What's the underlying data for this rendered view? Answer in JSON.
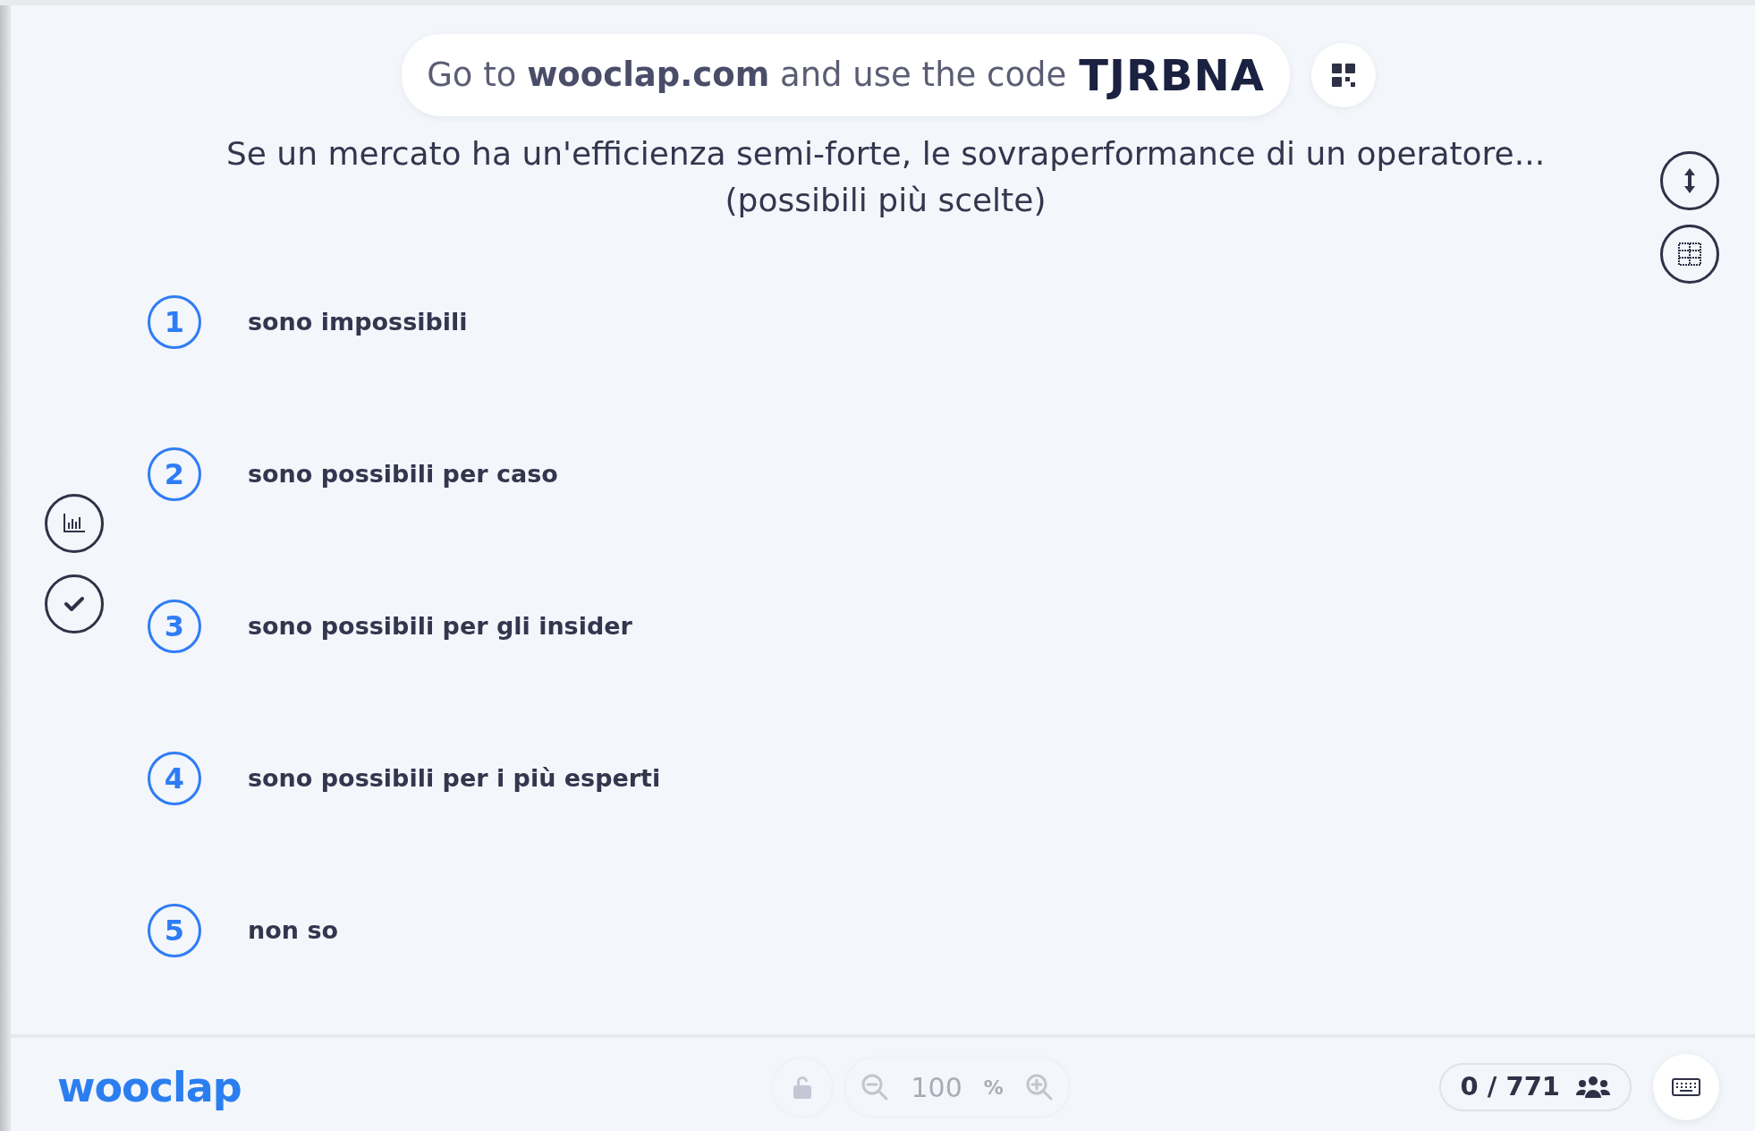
{
  "banner": {
    "instruction": "Go to **wooclap.com** and use the code",
    "code": "TJRBNA"
  },
  "question": {
    "title": "Se un mercato ha un'efficienza semi-forte, le sovraperformance di un operatore...",
    "note": "(possibili più scelte)"
  },
  "options": [
    {
      "number": "1",
      "label": "sono impossibili"
    },
    {
      "number": "2",
      "label": "sono possibili per caso"
    },
    {
      "number": "3",
      "label": "sono possibili per gli insider"
    },
    {
      "number": "4",
      "label": "sono possibili per i più esperti"
    },
    {
      "number": "5",
      "label": "non so"
    }
  ],
  "footer": {
    "logo": "wooclap",
    "zoom_value": "100",
    "zoom_unit": "%",
    "participants": "0 / 771"
  }
}
